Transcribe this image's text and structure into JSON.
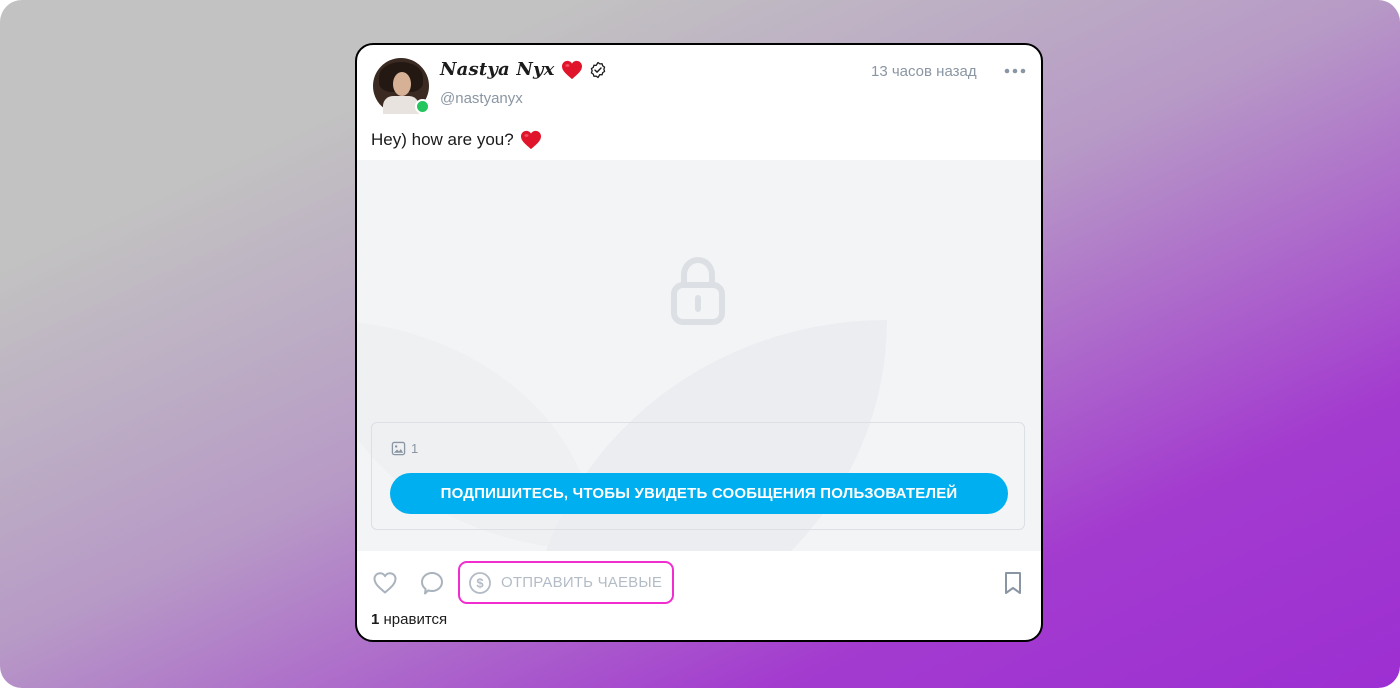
{
  "post": {
    "author": {
      "name": "Nastya Nyx",
      "name_emoji": "heart-icon",
      "verified_icon": "verified-badge-icon",
      "handle": "@nastyanyx",
      "online": true
    },
    "timestamp": "13 часов назад",
    "more_icon": "more-horizontal-icon",
    "text": "Hey) how are you?",
    "text_emoji": "heart-icon",
    "locked": true,
    "media_count": "1",
    "subscribe_label": "ПОДПИШИТЕСЬ, ЧТОБЫ УВИДЕТЬ СООБЩЕНИЯ ПОЛЬЗОВАТЕЛЕЙ",
    "actions": {
      "like_icon": "heart-outline-icon",
      "comment_icon": "comment-icon",
      "tip_label": "ОТПРАВИТЬ ЧАЕВЫЕ",
      "tip_icon": "dollar-circle-icon",
      "bookmark_icon": "bookmark-icon"
    },
    "likes_count": "1",
    "likes_label": "нравится"
  },
  "colors": {
    "accent": "#00aff0",
    "highlight": "#f22dd0",
    "muted": "#8a96a3",
    "online": "#22c55e",
    "heart": "#e0152b"
  }
}
